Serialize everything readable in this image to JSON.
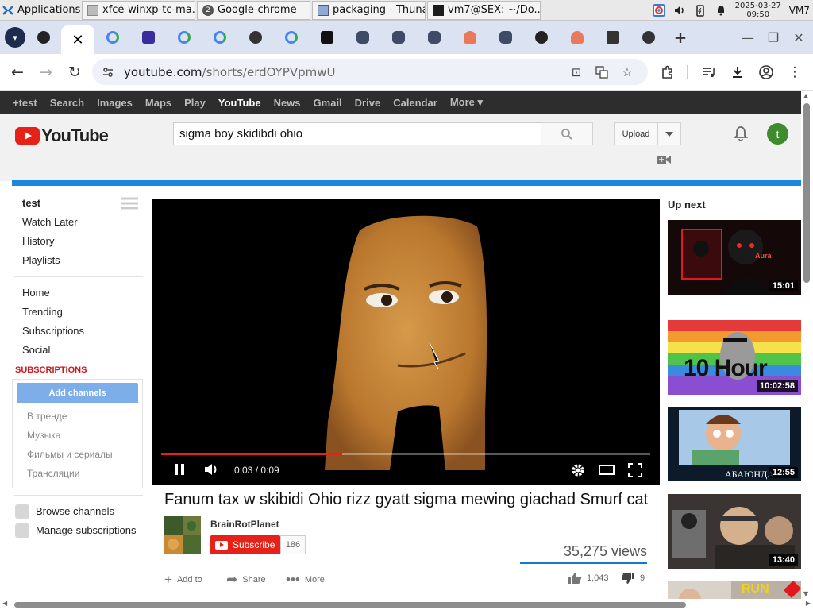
{
  "taskbar": {
    "apps_label": "Applications",
    "windows": [
      {
        "label": "xfce-winxp-tc-ma..."
      },
      {
        "label": "Google-chrome",
        "badge": "2"
      },
      {
        "label": "packaging - Thunar"
      },
      {
        "label": "vm7@SEX: ~/Do..."
      }
    ],
    "date": "2025-03-27",
    "time": "09:50",
    "host": "VM7"
  },
  "browser": {
    "url_host": "youtube.com",
    "url_path": "/shorts/erdOYPVpmwU",
    "tab_close": "✕",
    "new_tab": "+"
  },
  "gbar": {
    "items": [
      "+test",
      "Search",
      "Images",
      "Maps",
      "Play",
      "YouTube",
      "News",
      "Gmail",
      "Drive",
      "Calendar",
      "More ▾"
    ],
    "active": "YouTube"
  },
  "youtube": {
    "logo_text": "YouTube",
    "search_value": "sigma boy skidibdi ohio",
    "upload_label": "Upload",
    "avatar_letter": "t"
  },
  "guide": {
    "user": "test",
    "user_items": [
      "Watch Later",
      "History",
      "Playlists"
    ],
    "main_items": [
      "Home",
      "Trending",
      "Subscriptions",
      "Social"
    ],
    "subscriptions_heading": "SUBSCRIPTIONS",
    "add_channels": "Add channels",
    "subscription_items": [
      "В тренде",
      "Музыка",
      "Фильмы и сериалы",
      "Трансляции"
    ],
    "browse_channels": "Browse channels",
    "manage_subscriptions": "Manage subscriptions"
  },
  "player": {
    "time_current": "0:03",
    "time_total": "0:09",
    "time_display": "0:03 / 0:09",
    "progress": 0.37
  },
  "video": {
    "title": "Fanum tax w skibidi Ohio rizz gyatt sigma mewing giachad Smurf cat",
    "channel": "BrainRotPlanet",
    "subscribe_label": "Subscribe",
    "subscriber_count": "186",
    "views": "35,275 views",
    "add_to": "Add to",
    "share": "Share",
    "more": "More",
    "likes": "1,043",
    "dislikes": "9"
  },
  "up_next": {
    "heading": "Up next",
    "videos": [
      {
        "duration": "15:01",
        "overlay": "Aura"
      },
      {
        "duration": "10:02:58",
        "overlay": "10 Hour"
      },
      {
        "duration": "12:55",
        "overlay": "АБАЮНДА"
      },
      {
        "duration": "13:40",
        "overlay": ""
      },
      {
        "duration": "",
        "overlay": "RUN"
      }
    ]
  },
  "colors": {
    "yt_red": "#e62117",
    "tab_strip": "#dbe3f3",
    "gbar_bg": "#2d2d2d",
    "accent_blue": "#1a88dd"
  }
}
